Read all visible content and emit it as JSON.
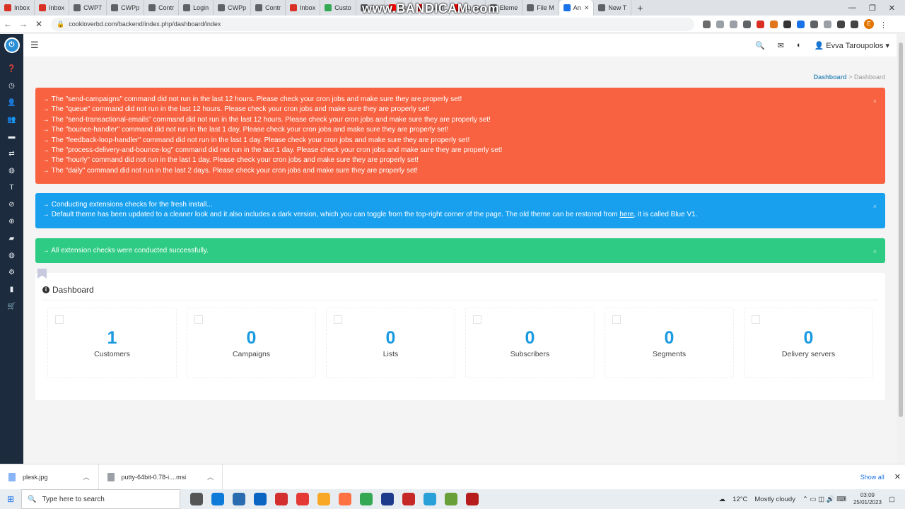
{
  "browser": {
    "tabs": [
      {
        "label": "Inbox",
        "color": "#d93025"
      },
      {
        "label": "Inbox",
        "color": "#d93025"
      },
      {
        "label": "CWP7",
        "color": "#5f6368"
      },
      {
        "label": "CWPp",
        "color": "#5f6368"
      },
      {
        "label": "Contr",
        "color": "#5f6368"
      },
      {
        "label": "Login",
        "color": "#5f6368"
      },
      {
        "label": "CWPp",
        "color": "#5f6368"
      },
      {
        "label": "Contr",
        "color": "#5f6368"
      },
      {
        "label": "Inbox",
        "color": "#d93025"
      },
      {
        "label": "Custo",
        "color": "#34a853"
      },
      {
        "label": "Am",
        "color": "#5f6368"
      },
      {
        "label": "Be",
        "color": "#ff0000"
      },
      {
        "label": "Chann",
        "color": "#ff0000"
      },
      {
        "label": "(1) Ev",
        "color": "#ff0000"
      },
      {
        "label": "Eleme",
        "color": "#5f6368"
      },
      {
        "label": "File M",
        "color": "#5f6368"
      },
      {
        "label": "An",
        "color": "#1a73e8"
      },
      {
        "label": "New T",
        "color": "#5f6368"
      }
    ],
    "active_tab_index": 16,
    "watermark": "www.BANDICAM.com",
    "url": "cookloverbd.com/backend/index.php/dashboard/index",
    "profile_initial": "E"
  },
  "topbar": {
    "user_name": "Evva Taroupolos"
  },
  "breadcrumb": {
    "link": "Dashboard",
    "separator": ">",
    "current": "Dashboard"
  },
  "alerts": {
    "red": [
      "→ The \"send-campaigns\" command did not run in the last 12 hours. Please check your cron jobs and make sure they are properly set!",
      "→ The \"queue\" command did not run in the last 12 hours. Please check your cron jobs and make sure they are properly set!",
      "→ The \"send-transactional-emails\" command did not run in the last 12 hours. Please check your cron jobs and make sure they are properly set!",
      "→ The \"bounce-handler\" command did not run in the last 1 day. Please check your cron jobs and make sure they are properly set!",
      "→ The \"feedback-loop-handler\" command did not run in the last 1 day. Please check your cron jobs and make sure they are properly set!",
      "→ The \"process-delivery-and-bounce-log\" command did not run in the last 1 day. Please check your cron jobs and make sure they are properly set!",
      "→ The \"hourly\" command did not run in the last 1 day. Please check your cron jobs and make sure they are properly set!",
      "→ The \"daily\" command did not run in the last 2 days. Please check your cron jobs and make sure they are properly set!"
    ],
    "blue_line1": "→ Conducting extensions checks for the fresh install...",
    "blue_line2_pre": "→ Default theme has been updated to a cleaner look and it also includes a dark version, which you can toggle from the top-right corner of the page. The old theme can be restored from ",
    "blue_link": "here",
    "blue_line2_post": ", it is called Blue V1.",
    "green": "→ All extension checks were conducted successfully.",
    "close": "×"
  },
  "dashboard": {
    "title": "Dashboard",
    "cards": [
      {
        "value": "1",
        "label": "Customers"
      },
      {
        "value": "0",
        "label": "Campaigns"
      },
      {
        "value": "0",
        "label": "Lists"
      },
      {
        "value": "0",
        "label": "Subscribers"
      },
      {
        "value": "0",
        "label": "Segments"
      },
      {
        "value": "0",
        "label": "Delivery servers"
      }
    ]
  },
  "downloads": {
    "items": [
      "plesk.jpg",
      "putty-64bit-0.78-i....msi"
    ],
    "show_all": "Show all"
  },
  "taskbar": {
    "search_placeholder": "Type here to search",
    "weather_temp": "12°C",
    "weather_text": "Mostly cloudy",
    "time": "03:09",
    "date": "25/01/2023"
  }
}
